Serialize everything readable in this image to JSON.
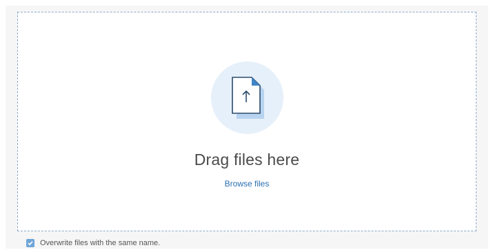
{
  "dropzone": {
    "title": "Drag files here",
    "browse_label": "Browse files",
    "icon": "file-upload-icon"
  },
  "options": {
    "overwrite_label": "Overwrite files with the same name.",
    "overwrite_checked": true
  },
  "colors": {
    "accent": "#2a6fb1",
    "dashed_border": "#8aa9c9",
    "icon_circle": "#e6f0fa",
    "checkbox": "#6fa6d8"
  }
}
